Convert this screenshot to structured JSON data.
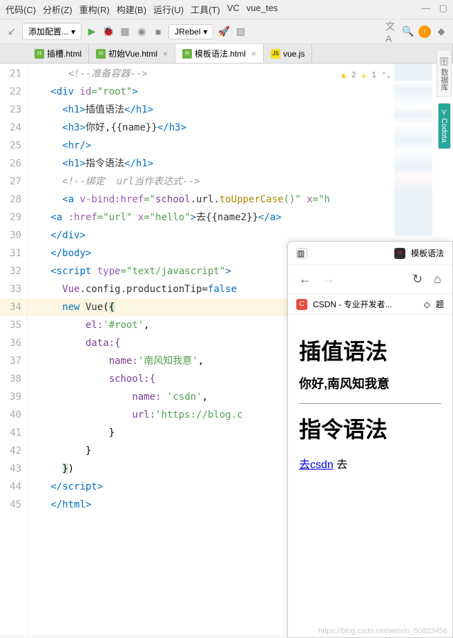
{
  "menu": {
    "items": [
      "代码(C)",
      "分析(Z)",
      "重构(R)",
      "构建(B)",
      "运行(U)",
      "工具(T)",
      "VC"
    ],
    "title": "vue_tes"
  },
  "toolbar": {
    "config": "添加配置...",
    "jrebel": "JRebel"
  },
  "tabs": [
    {
      "label": "插槽.html",
      "type": "html"
    },
    {
      "label": "初始Vue.html",
      "type": "html"
    },
    {
      "label": "模板语法.html",
      "type": "html",
      "active": true
    },
    {
      "label": "vue.js",
      "type": "js"
    }
  ],
  "sidebar": {
    "db": "数据库",
    "codota": "Codota"
  },
  "warnings": {
    "w1": "2",
    "w2": "1"
  },
  "lines": [
    "21",
    "22",
    "23",
    "24",
    "25",
    "26",
    "27",
    "28",
    "29",
    "30",
    "31",
    "32",
    "33",
    "34",
    "35",
    "36",
    "37",
    "38",
    "39",
    "40",
    "41",
    "42",
    "43",
    "44",
    "45"
  ],
  "code": {
    "l21": "<!--准备容器-->",
    "l22a": "<",
    "l22b": "div",
    "l22c": " id",
    "l22d": "=\"root\"",
    "l22e": ">",
    "l23a": "<",
    "l23b": "h1",
    "l23c": ">",
    "l23d": "插值语法",
    "l23e": "</",
    "l23f": "h1",
    "l23g": ">",
    "l24a": "<",
    "l24b": "h3",
    "l24c": ">",
    "l24d": "你好,{{name}}",
    "l24e": "</",
    "l24f": "h3",
    "l24g": ">",
    "l25a": "<",
    "l25b": "hr",
    "l25c": "/>",
    "l26a": "<",
    "l26b": "h1",
    "l26c": ">",
    "l26d": "指令语法",
    "l26e": "</",
    "l26f": "h1",
    "l26g": ">",
    "l27": "<!--绑定  url当作表达式-->",
    "l28a": "<",
    "l28b": "a",
    "l28c": " v-bind:href",
    "l28d": "=\"",
    "l28e": "school",
    "l28f": ".url.",
    "l28g": "toUpperCase",
    "l28h": "()\"",
    "l28i": " x",
    "l28j": "=\"h",
    "l29a": "<",
    "l29b": "a",
    "l29c": " :href",
    "l29d": "=\"url\"",
    "l29e": " x",
    "l29f": "=\"hello\"",
    "l29g": ">",
    "l29h": "去{{name2}}",
    "l29i": "</",
    "l29j": "a",
    "l29k": ">",
    "l30a": "</",
    "l30b": "div",
    "l30c": ">",
    "l31a": "</",
    "l31b": "body",
    "l31c": ">",
    "l32a": "<",
    "l32b": "script",
    "l32c": " type",
    "l32d": "=\"text/javascript\"",
    "l32e": ">",
    "l33a": "Vue",
    "l33b": ".config.productionTip=",
    "l33c": "false",
    "l34a": "new ",
    "l34b": "Vue",
    "l34c": "(",
    "l34d": "{",
    "l35a": "el:",
    "l35b": "'#root'",
    "l35c": ",",
    "l36a": "data:{",
    "l37a": "name:",
    "l37b": "'南风知我意'",
    "l37c": ",",
    "l38a": "school:{",
    "l39a": "name: ",
    "l39b": "'csdn'",
    "l39c": ",",
    "l40a": "url:",
    "l40b": "'https://blog.c",
    "l41": "}",
    "l42": "}",
    "l43a": "}",
    "l43b": ")",
    "l44a": "</",
    "l44b": "script",
    "l44c": ">",
    "l45a": "</",
    "l45b": "html",
    "l45c": ">"
  },
  "browser": {
    "tab": "模板语法",
    "bookmark": "CSDN - 专业开发者...",
    "bm2": "题",
    "h1a": "插值语法",
    "h3": "你好,南风知我意",
    "h1b": "指令语法",
    "link": "去csdn",
    "after": " 去"
  },
  "watermark": "https://blog.csdn.net/weixin_50823456"
}
